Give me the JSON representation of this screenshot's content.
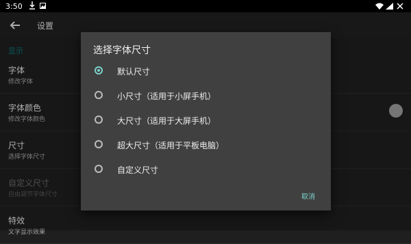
{
  "status_bar": {
    "time": "3:50"
  },
  "app_bar": {
    "title": "设置"
  },
  "settings": {
    "section_label": "显示",
    "items": [
      {
        "title": "字体",
        "subtitle": "修改字体"
      },
      {
        "title": "字体颜色",
        "subtitle": "修改字体颜色"
      },
      {
        "title": "尺寸",
        "subtitle": "选择字体尺寸"
      },
      {
        "title": "自定义尺寸",
        "subtitle": "自由调节字体尺寸"
      },
      {
        "title": "特效",
        "subtitle": "文字显示效果"
      }
    ]
  },
  "dialog": {
    "title": "选择字体尺寸",
    "options": [
      {
        "label": "默认尺寸",
        "checked": true
      },
      {
        "label": "小尺寸（适用于小屏手机）",
        "checked": false
      },
      {
        "label": "大尺寸（适用于大屏手机）",
        "checked": false
      },
      {
        "label": "超大尺寸（适用于平板电脑）",
        "checked": false
      },
      {
        "label": "自定义尺寸",
        "checked": false
      }
    ],
    "cancel_label": "取消"
  },
  "colors": {
    "accent": "#7bd1cc",
    "dialog_bg": "#404040",
    "background": "#1f1f1f"
  }
}
